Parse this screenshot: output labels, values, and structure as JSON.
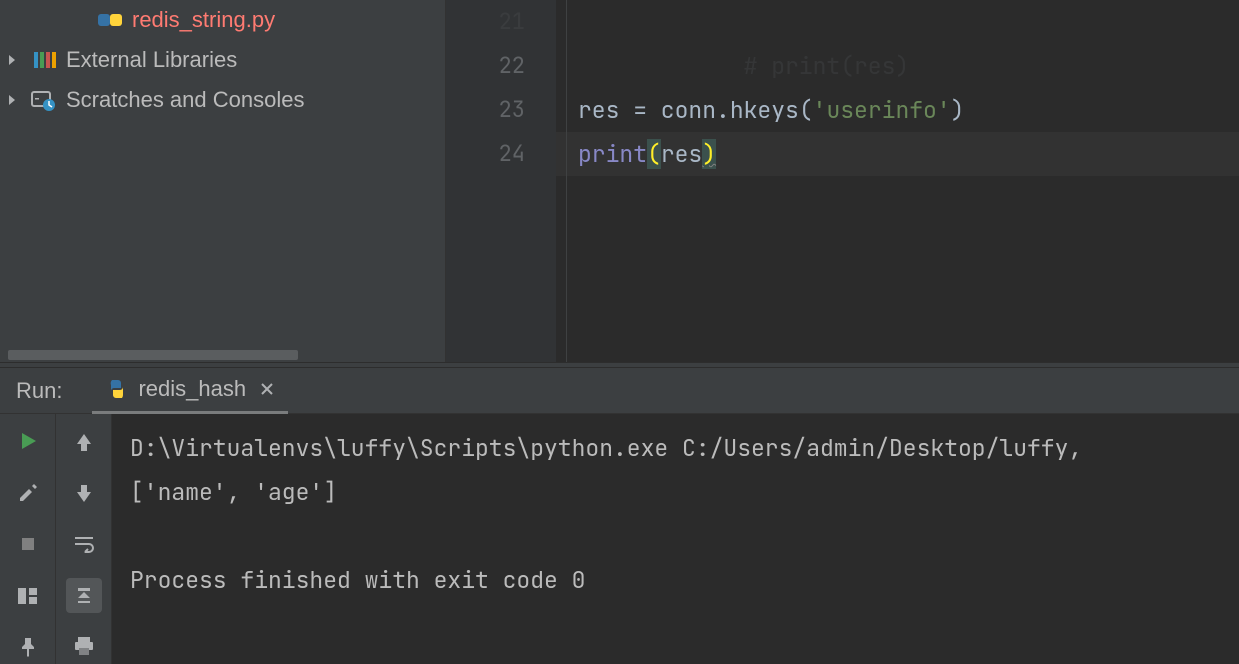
{
  "sidebar": {
    "file": {
      "name": "redis_string.py"
    },
    "nodes": [
      {
        "label": "External Libraries"
      },
      {
        "label": "Scratches and Consoles"
      }
    ]
  },
  "editor": {
    "gutter": [
      "21",
      "22",
      "23",
      "24"
    ],
    "line21_comment": "# print(res)",
    "line23": {
      "a": "res = conn.",
      "b": "hkeys",
      "c": "(",
      "str": "'userinfo'",
      "d": ")"
    },
    "line24": {
      "print": "print",
      "lp": "(",
      "arg": "res",
      "rp": ")"
    }
  },
  "run": {
    "title": "Run:",
    "tab": {
      "label": "redis_hash"
    },
    "console": {
      "l1": "D:\\Virtualenvs\\luffy\\Scripts\\python.exe C:/Users/admin/Desktop/luffy,",
      "l2": "['name', 'age']",
      "l3": "",
      "l4": "Process finished with exit code 0"
    }
  }
}
